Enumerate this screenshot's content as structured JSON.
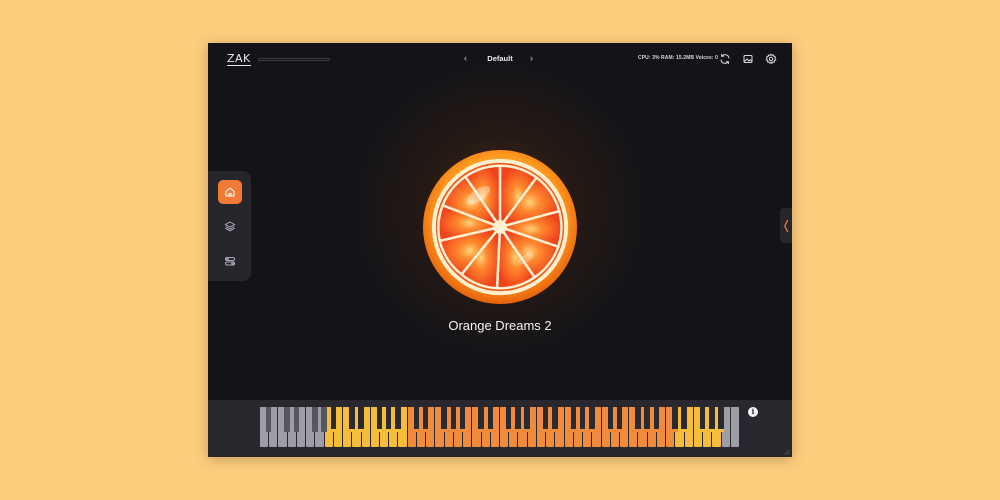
{
  "header": {
    "logo": "ZAK",
    "preset_prev": "‹",
    "preset_name": "Default",
    "preset_next": "›",
    "stats": "CPU: 3% RAM: 15.2MB Voices: 0",
    "icons": [
      "refresh-icon",
      "image-icon",
      "gear-icon"
    ]
  },
  "sidebar": {
    "items": [
      {
        "name": "home",
        "icon": "home-icon",
        "active": true
      },
      {
        "name": "layers",
        "icon": "layers-icon",
        "active": false
      },
      {
        "name": "controls",
        "icon": "toggles-icon",
        "active": false
      }
    ]
  },
  "right_tab": {
    "icon": "chevron-left-icon"
  },
  "main": {
    "artwork": "orange-slice",
    "title": "Orange Dreams 2"
  },
  "keyboard": {
    "info": "i",
    "white_key_count": 52,
    "colors": {
      "gray": "#9d9da6",
      "gray_black": "#56565e",
      "yellow": "#f5bd3a",
      "orange": "#f08a3c",
      "black": "#2a2a30"
    }
  },
  "colors": {
    "background": "#fdcd7e",
    "window": "#141418",
    "accent": "#f07a36",
    "text": "#ededf2"
  }
}
